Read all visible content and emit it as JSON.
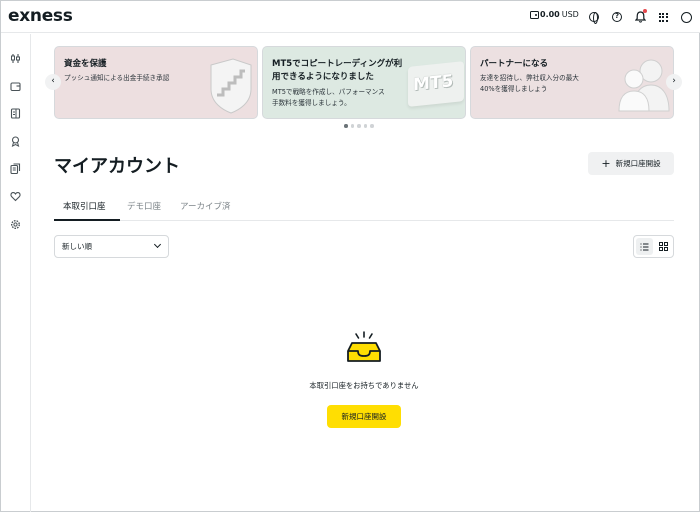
{
  "header": {
    "logo": "exness",
    "balance_amount": "0.00",
    "balance_currency": "USD",
    "icons": [
      "wallet-icon",
      "globe-icon",
      "help-icon",
      "bell-icon",
      "apps-grid-icon",
      "profile-icon"
    ]
  },
  "sidebar": {
    "icons": [
      "trading-icon",
      "wallet-icon",
      "document-icon",
      "rewards-icon",
      "copy-icon",
      "favorites-icon",
      "settings-icon"
    ]
  },
  "banners": [
    {
      "title": "資金を保護",
      "body": [
        "プッシュ通知による出金手続き承認"
      ]
    },
    {
      "title": [
        "MT5でコピートレーディングが利",
        "用できるようになりました"
      ],
      "body": [
        "MT5で戦略を作成し、パフォーマンス",
        "手数料を獲得しましょう。"
      ],
      "art_text": "MT5"
    },
    {
      "title": "パートナーになる",
      "body": [
        "友達を招待し、弊社収入分の最大",
        "40%を獲得しましょう"
      ]
    }
  ],
  "carousel": {
    "total": 5,
    "active": 0
  },
  "page": {
    "title": "マイアカウント",
    "new_account_button": "新規口座開設"
  },
  "tabs": [
    {
      "label": "本取引口座",
      "active": true
    },
    {
      "label": "デモ口座",
      "active": false
    },
    {
      "label": "アーカイブ済",
      "active": false
    }
  ],
  "sort": {
    "selected": "新しい順"
  },
  "empty_state": {
    "message": "本取引口座をお持ちでありません",
    "cta": "新規口座開設"
  },
  "colors": {
    "accent": "#ffde02",
    "text": "#141d22",
    "notification": "#e5484d"
  }
}
